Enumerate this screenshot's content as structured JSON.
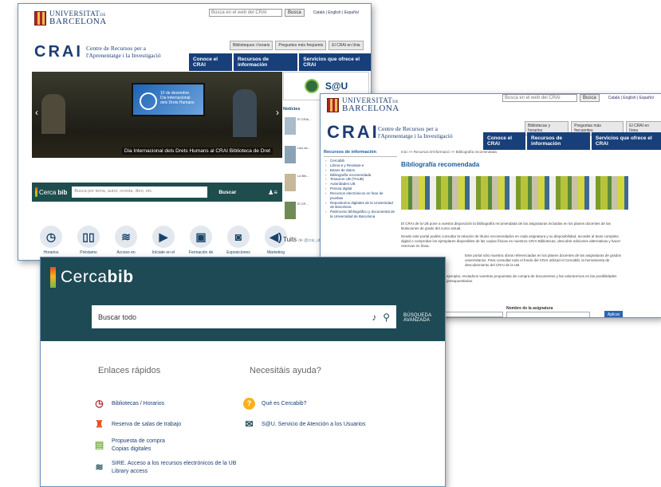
{
  "w1": {
    "ub_line1": "UNIVERSITAT",
    "ub_de": "DE",
    "ub_line2": "BARCELONA",
    "search_placeholder": "Busca en el web del CRAI",
    "search_btn": "Busca",
    "langs": "Català | English | Español",
    "crai": "CRAI",
    "crai_sub1": "Centre de Recursos per a",
    "crai_sub2": "l'Aprenentatge i la Investigació",
    "gray_buttons": [
      "Biblioteques i horaris",
      "Preguntes més freqüents",
      "El CRAI en línia"
    ],
    "nav": [
      "Conoce el CRAI",
      "Recursos de información",
      "Servicios que ofrece el CRAI"
    ],
    "hero_screen": "10 de desembre\nDia Internacional\ndels Drets Humans",
    "hero_caption": "Dia Internacional dels Drets Humans al CRAI Biblioteca de Dret",
    "cercabib_search": "Busca por tema, autor, revista, libro, etc.",
    "cercabib_btn": "Buscar",
    "cercabib_logo_a": "Cerca",
    "cercabib_logo_b": "bib",
    "icons": [
      {
        "label": "Horarios",
        "icon": "clock-icon",
        "glyph": "◷"
      },
      {
        "label": "Préstamo",
        "icon": "book-icon",
        "glyph": "▯▯"
      },
      {
        "label": "Acceso en",
        "icon": "wifi-icon",
        "glyph": "≋"
      },
      {
        "label": "Iníciate en el",
        "icon": "play-icon",
        "glyph": "▶"
      },
      {
        "label": "Formación de",
        "icon": "screen-icon",
        "glyph": "▣"
      },
      {
        "label": "Exposiciones",
        "icon": "camera-icon",
        "glyph": "◙"
      },
      {
        "label": "Marketing",
        "icon": "megaphone-icon",
        "glyph": "◀)"
      }
    ],
    "sau": "S@U",
    "news_title": "Notícies",
    "news_items": [
      "El CRAI...",
      "Uso de...",
      "La Bib...",
      "El CR..."
    ],
    "tuits": "Tuits",
    "tuits_handle": "de @crai_ub"
  },
  "w2": {
    "ub_line1": "UNIVERSITAT",
    "ub_de": "DE",
    "ub_line2": "BARCELONA",
    "search_placeholder": "Busca en el web del CRAI",
    "search_btn": "Busca",
    "langs": "Català | English | Español",
    "crai": "CRAI",
    "crai_sub1": "Centre de Recursos per a",
    "crai_sub2": "l'Aprenentatge i la Investigació",
    "gray_buttons": [
      "Bibliotecas y horarios",
      "Preguntas más frecuentes",
      "El CRAI en línea"
    ],
    "nav": [
      "Conoce el CRAI",
      "Recursos de información",
      "Servicios que ofrece el CRAI"
    ],
    "side_heading": "Recursos de información",
    "side_items": [
      "Cercabib",
      "Libros-e y Revistas-e",
      "Bases de datos",
      "Bibliografía recomendada",
      "Tesauros UB (THUB)",
      "Autoridades UB",
      "Prensa digital",
      "Recursos electrónicos en fase de pruebas",
      "Repositorios digitales de la Universidad de Barcelona",
      "Patrimonio bibliográfico y documental de la Universidad de Barcelona"
    ],
    "breadcrumb": "Inici >> Recursos D'informació >> Bibliografía recomendada",
    "title": "Bibliografía recomendada",
    "p1": "El CRAI de la UB pone a vuestra disposición la bibliografía recomendada de las asignaturas incluidas en los planes docentes de las titulaciones de grado del curso actual.",
    "p2": "Desde este portal podéis consultar la relación de títulos recomendados en cada asignatura y su disponibilidad, acceder al texto completo digital o comprobar los ejemplares disponibles de las copias físicas en nuestros CRAI Bibliotecas, descubrir ediciones alternativas y hacer reservas en línea.",
    "p3": "Este portal sólo muestra obras referenciadas en los planes docentes de las asignaturas de grados universitarios. Para consultar todo el fondo del CRAI utilizad el Cercabib, la herramienta de descubrimiento del CRAI de la UB.",
    "p4": "ejemplar, enviadnos vuestras propuestas de compra de documentos y las valoraremos en las posibilidades presupuestarias.",
    "asig_label": "Nombre de la asignatura",
    "aplicar": "Aplicar"
  },
  "w3": {
    "logo_a": "Cerca",
    "logo_b": "bib",
    "search_placeholder": "Buscar todo",
    "advanced": "BÚSQUEDA AVANZADA",
    "col1_title": "Enlaces rápidos",
    "col2_title": "Necesitáis ayuda?",
    "links": [
      {
        "icon": "clock-icon",
        "text": "Bibliotecas / Horarios",
        "color": "#b0222a"
      },
      {
        "icon": "armchair-icon",
        "text": "Reserva de salas de trabajo",
        "color": "#e94e1b"
      },
      {
        "icon": "document-icon",
        "text": "Propuesta de compra\nCopias digitales",
        "color": "#7ab648"
      },
      {
        "icon": "wifi-icon",
        "text": "SIRE. Acceso a los recursos electrónicos de la UB\nLibrary access",
        "color": "#1d4a55"
      }
    ],
    "help_links": [
      {
        "icon": "question-icon",
        "text": "Qué es Cercabib?",
        "color": "#f7b21f"
      },
      {
        "icon": "envelope-icon",
        "text": "S@U. Servicio de Atención a los Usuarios",
        "color": "#1d4a55"
      }
    ]
  }
}
